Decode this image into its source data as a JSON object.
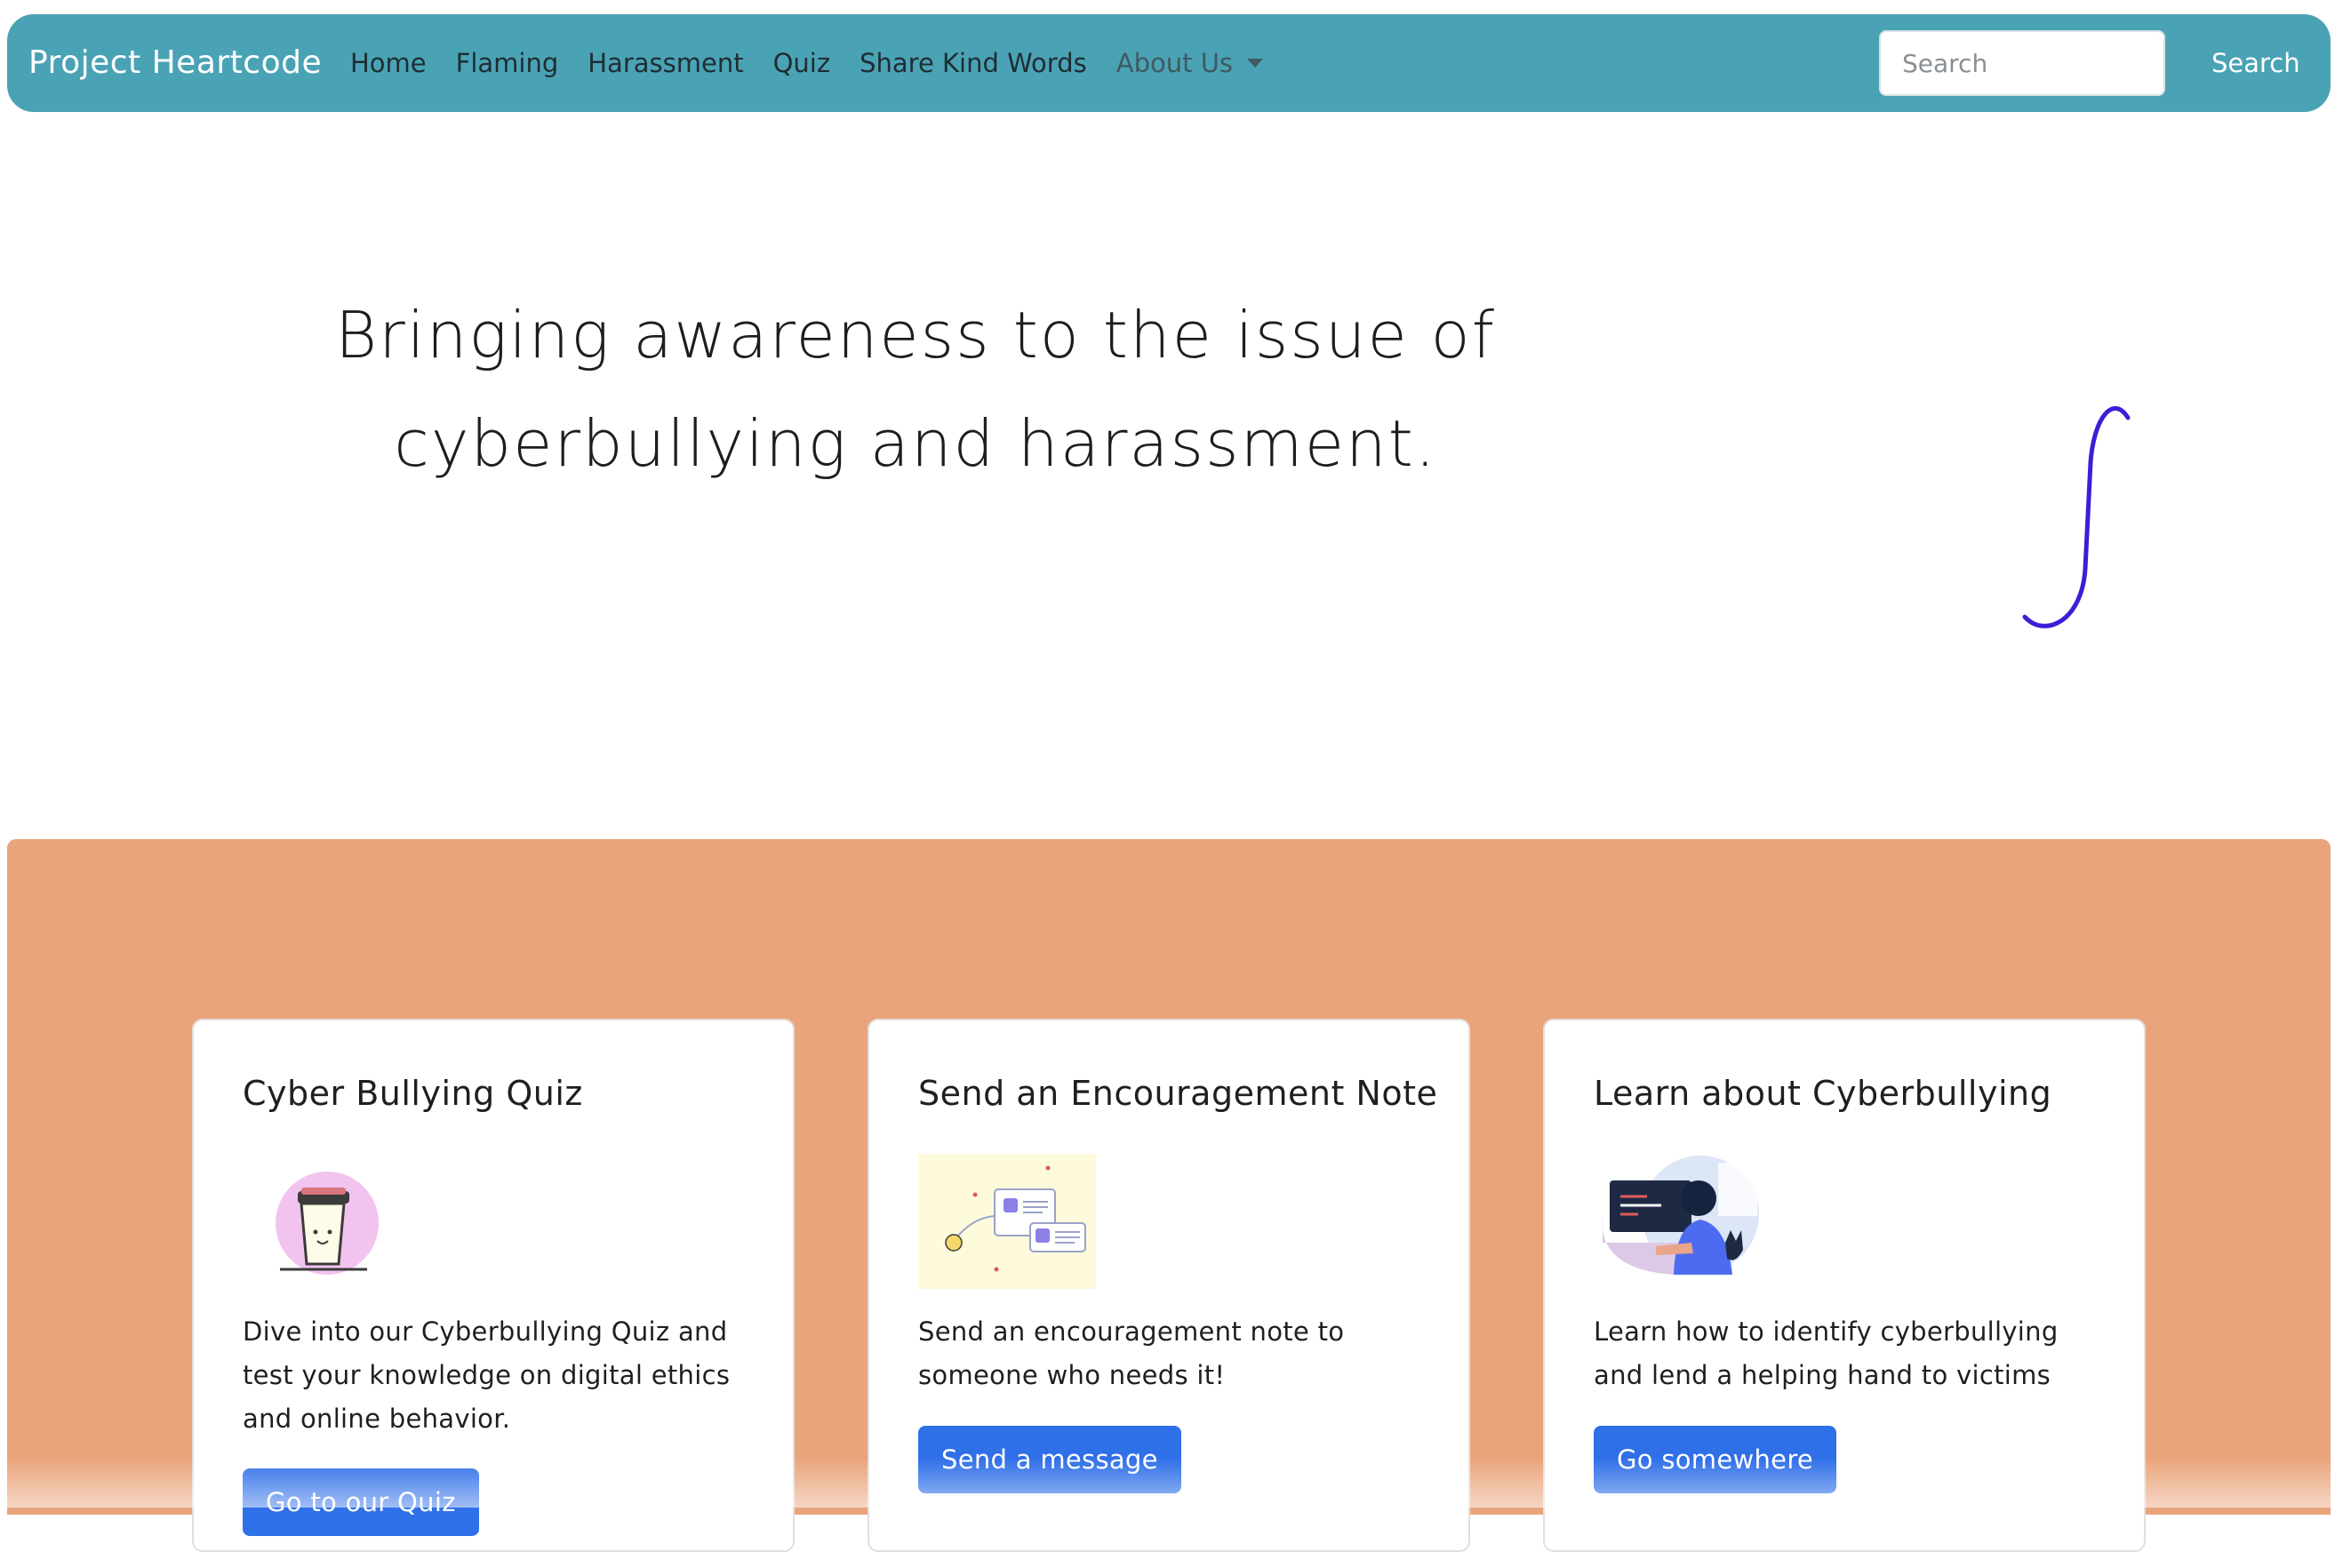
{
  "navbar": {
    "brand": "Project Heartcode",
    "links": [
      "Home",
      "Flaming",
      "Harassment",
      "Quiz",
      "Share Kind Words"
    ],
    "dropdown_label": "About Us",
    "search_placeholder": "Search",
    "search_button": "Search"
  },
  "hero": {
    "title": "Bringing awareness to the issue of cyberbullying and harassment."
  },
  "cards": [
    {
      "title": "Cyber Bullying Quiz",
      "text": "Dive into our Cyberbullying Quiz and test your knowledge on digital ethics and online behavior.",
      "button": "Go to our Quiz",
      "image_icon": "coffee-cup-illustration"
    },
    {
      "title": "Send an Encouragement Note",
      "text": "Send an encouragement note to someone who needs it!",
      "button": "Send a message",
      "image_icon": "messages-illustration"
    },
    {
      "title": "Learn about Cyberbullying",
      "text": "Learn how to identify cyberbullying and lend a helping hand to victims",
      "button": "Go somewhere",
      "image_icon": "person-at-computer-illustration"
    }
  ],
  "colors": {
    "navbar": "#4aa3b4",
    "band": "#eaa47c",
    "button": "#2f6fe8",
    "squiggle": "#3a1fd6"
  }
}
